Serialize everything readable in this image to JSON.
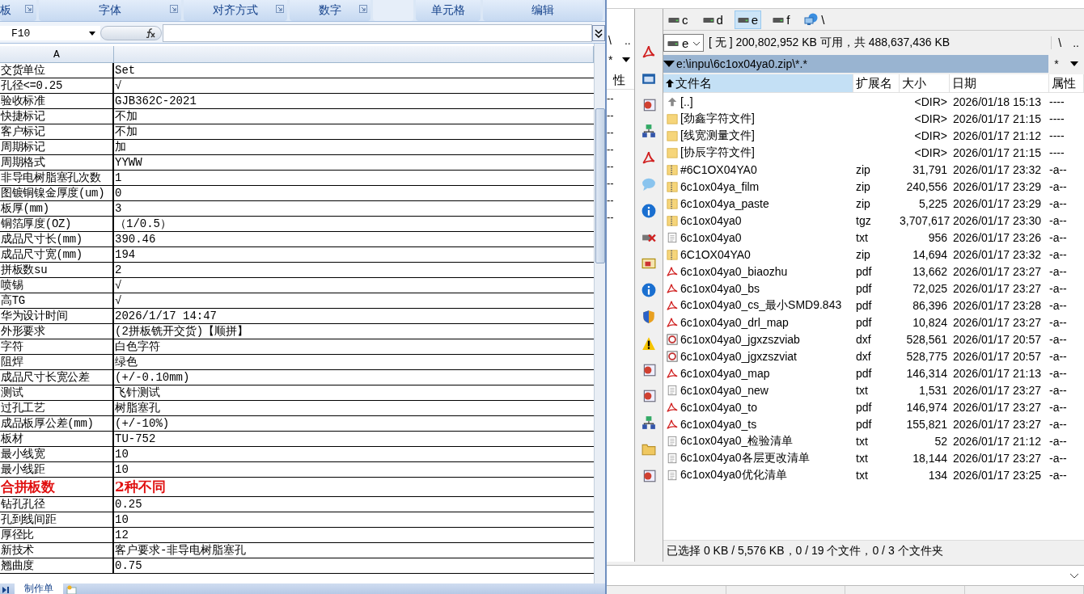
{
  "excel": {
    "ribbon_groups": [
      {
        "label": "板",
        "launcher": true
      },
      {
        "label": "字体",
        "launcher": true
      },
      {
        "label": "对齐方式",
        "launcher": true
      },
      {
        "label": "数字",
        "launcher": true
      },
      {
        "launcher": false
      },
      {
        "label": "单元格",
        "launcher": false
      },
      {
        "label": "编辑",
        "launcher": false
      }
    ],
    "name_box": "F10",
    "column_header": "A",
    "rows": [
      {
        "label": "交货单位",
        "value": "Set",
        "kind": "normal"
      },
      {
        "label": "孔径<=0.25",
        "value": "√",
        "kind": "normal"
      },
      {
        "label": "验收标准",
        "value": "GJB362C-2021",
        "kind": "normal"
      },
      {
        "label": "快捷标记",
        "value": "不加",
        "kind": "normal"
      },
      {
        "label": "客户标记",
        "value": "不加",
        "kind": "normal"
      },
      {
        "label": "周期标记",
        "value": "加",
        "kind": "normal"
      },
      {
        "label": "周期格式",
        "value": "YYWW",
        "kind": "normal"
      },
      {
        "label": "非导电树脂塞孔次数",
        "value": "1",
        "kind": "normal"
      },
      {
        "label": "图镀铜镍金厚度(um)",
        "value": "0",
        "kind": "normal"
      },
      {
        "label": "板厚(mm)",
        "value": "3",
        "kind": "normal"
      },
      {
        "label": "铜箔厚度(OZ)",
        "value": "（1/0.5）",
        "kind": "normal"
      },
      {
        "label": "成品尺寸长(mm)",
        "value": "390.46",
        "kind": "normal"
      },
      {
        "label": "成品尺寸宽(mm)",
        "value": "194",
        "kind": "normal"
      },
      {
        "label": "拼板数su",
        "value": "2",
        "kind": "normal"
      },
      {
        "label": "喷锡",
        "value": "√",
        "kind": "normal"
      },
      {
        "label": "高TG",
        "value": "√",
        "kind": "normal"
      },
      {
        "label": "华为设计时间",
        "value": "2026/1/17 14:47",
        "kind": "normal"
      },
      {
        "label": "外形要求",
        "value": "(2拼板铣开交货)【顺拼】",
        "kind": "normal"
      },
      {
        "label": "字符",
        "value": "白色字符",
        "kind": "normal"
      },
      {
        "label": "阻焊",
        "value": "绿色",
        "kind": "normal"
      },
      {
        "label": "成品尺寸长宽公差",
        "value": "(+/-0.10mm)",
        "kind": "normal"
      },
      {
        "label": "测试",
        "value": "飞针测试",
        "kind": "normal"
      },
      {
        "label": "过孔工艺",
        "value": "树脂塞孔",
        "kind": "normal"
      },
      {
        "label": "成品板厚公差(mm)",
        "value": "(+/-10%)",
        "kind": "normal"
      },
      {
        "label": "板材",
        "value": "TU-752",
        "kind": "normal"
      },
      {
        "label": "最小线宽",
        "value": "10",
        "kind": "normal"
      },
      {
        "label": "最小线距",
        "value": "10",
        "kind": "normal"
      },
      {
        "label": "合拼板数",
        "value": "2种不同",
        "kind": "highlight"
      },
      {
        "label": "钻孔孔径",
        "value": "0.25",
        "kind": "normal"
      },
      {
        "label": "孔到线间距",
        "value": "10",
        "kind": "normal"
      },
      {
        "label": "厚径比",
        "value": "12",
        "kind": "normal"
      },
      {
        "label": "新技术",
        "value": "客户要求-非导电树脂塞孔",
        "kind": "normal"
      },
      {
        "label": "翘曲度",
        "value": "0.75",
        "kind": "normal"
      }
    ],
    "sheet_tabs": [
      {
        "label": "制作单",
        "selected": true
      }
    ]
  },
  "commander": {
    "left_panel": {
      "root": "\\",
      "up": "..",
      "filter": "*",
      "header": "性",
      "rows": [
        "--",
        "--",
        "--",
        "--",
        "--",
        "--",
        "--",
        "--"
      ]
    },
    "drives": [
      {
        "kind": "drive",
        "letter": "c",
        "selected": false
      },
      {
        "kind": "drive",
        "letter": "d",
        "selected": false
      },
      {
        "kind": "drive",
        "letter": "e",
        "selected": true
      },
      {
        "kind": "drive",
        "letter": "f",
        "selected": false
      },
      {
        "kind": "network",
        "letter": "\\",
        "selected": false
      }
    ],
    "drive_combo": "e",
    "free_space": "[ 无 ]  200,802,952 KB 可用，共 488,637,436 KB",
    "root": "\\",
    "up": "..",
    "path": "e:\\inpu\\6c1ox04ya0.zip\\*.*",
    "filter": "*",
    "columns": [
      {
        "label": "文件名",
        "sorted": true
      },
      {
        "label": "扩展名",
        "sorted": false
      },
      {
        "label": "大小",
        "sorted": false
      },
      {
        "label": "日期",
        "sorted": false
      },
      {
        "label": "属性",
        "sorted": false
      }
    ],
    "files": [
      {
        "kind": "up",
        "name": "[..]",
        "size": "<DIR>",
        "date": "2026/01/18 15:13",
        "attr": "----"
      },
      {
        "kind": "folder",
        "name": "[劲鑫字符文件]",
        "size": "<DIR>",
        "date": "2026/01/17 21:15",
        "attr": "----"
      },
      {
        "kind": "folder",
        "name": "[线宽测量文件]",
        "size": "<DIR>",
        "date": "2026/01/17 21:12",
        "attr": "----"
      },
      {
        "kind": "folder",
        "name": "[协辰字符文件]",
        "size": "<DIR>",
        "date": "2026/01/17 21:15",
        "attr": "----"
      },
      {
        "kind": "archive",
        "name": "#6C1OX04YA0",
        "ext": "zip",
        "size": "31,791",
        "date": "2026/01/17 23:32",
        "attr": "-a--"
      },
      {
        "kind": "archive",
        "name": "6c1ox04ya_film",
        "ext": "zip",
        "size": "240,556",
        "date": "2026/01/17 23:29",
        "attr": "-a--"
      },
      {
        "kind": "archive",
        "name": "6c1ox04ya_paste",
        "ext": "zip",
        "size": "5,225",
        "date": "2026/01/17 23:29",
        "attr": "-a--"
      },
      {
        "kind": "archive",
        "name": "6c1ox04ya0",
        "ext": "tgz",
        "size": "3,707,617",
        "date": "2026/01/17 23:30",
        "attr": "-a--"
      },
      {
        "kind": "text",
        "name": "6c1ox04ya0",
        "ext": "txt",
        "size": "956",
        "date": "2026/01/17 23:26",
        "attr": "-a--"
      },
      {
        "kind": "archive",
        "name": "6C1OX04YA0",
        "ext": "zip",
        "size": "14,694",
        "date": "2026/01/17 23:32",
        "attr": "-a--"
      },
      {
        "kind": "pdf",
        "name": "6c1ox04ya0_biaozhu",
        "ext": "pdf",
        "size": "13,662",
        "date": "2026/01/17 23:27",
        "attr": "-a--"
      },
      {
        "kind": "pdf",
        "name": "6c1ox04ya0_bs",
        "ext": "pdf",
        "size": "72,025",
        "date": "2026/01/17 23:27",
        "attr": "-a--"
      },
      {
        "kind": "pdf",
        "name": "6c1ox04ya0_cs_最小SMD9.843",
        "ext": "pdf",
        "size": "86,396",
        "date": "2026/01/17 23:28",
        "attr": "-a--"
      },
      {
        "kind": "pdf",
        "name": "6c1ox04ya0_drl_map",
        "ext": "pdf",
        "size": "10,824",
        "date": "2026/01/17 23:27",
        "attr": "-a--"
      },
      {
        "kind": "dxf",
        "name": "6c1ox04ya0_jgxzszviab",
        "ext": "dxf",
        "size": "528,561",
        "date": "2026/01/17 20:57",
        "attr": "-a--"
      },
      {
        "kind": "dxf",
        "name": "6c1ox04ya0_jgxzszviat",
        "ext": "dxf",
        "size": "528,775",
        "date": "2026/01/17 20:57",
        "attr": "-a--"
      },
      {
        "kind": "pdf",
        "name": "6c1ox04ya0_map",
        "ext": "pdf",
        "size": "146,314",
        "date": "2026/01/17 21:13",
        "attr": "-a--"
      },
      {
        "kind": "text",
        "name": "6c1ox04ya0_new",
        "ext": "txt",
        "size": "1,531",
        "date": "2026/01/17 23:27",
        "attr": "-a--"
      },
      {
        "kind": "pdf",
        "name": "6c1ox04ya0_to",
        "ext": "pdf",
        "size": "146,974",
        "date": "2026/01/17 23:27",
        "attr": "-a--"
      },
      {
        "kind": "pdf",
        "name": "6c1ox04ya0_ts",
        "ext": "pdf",
        "size": "155,821",
        "date": "2026/01/17 23:27",
        "attr": "-a--"
      },
      {
        "kind": "text",
        "name": "6c1ox04ya0_检验清单",
        "ext": "txt",
        "size": "52",
        "date": "2026/01/17 21:12",
        "attr": "-a--"
      },
      {
        "kind": "text",
        "name": "6c1ox04ya0各层更改清单",
        "ext": "txt",
        "size": "18,144",
        "date": "2026/01/17 23:27",
        "attr": "-a--"
      },
      {
        "kind": "text",
        "name": "6c1ox04ya0优化清单",
        "ext": "txt",
        "size": "134",
        "date": "2026/01/17 23:25",
        "attr": "-a--"
      }
    ],
    "status": "已选择 0 KB / 5,576 KB，0 / 19 个文件，0 / 3 个文件夹"
  }
}
